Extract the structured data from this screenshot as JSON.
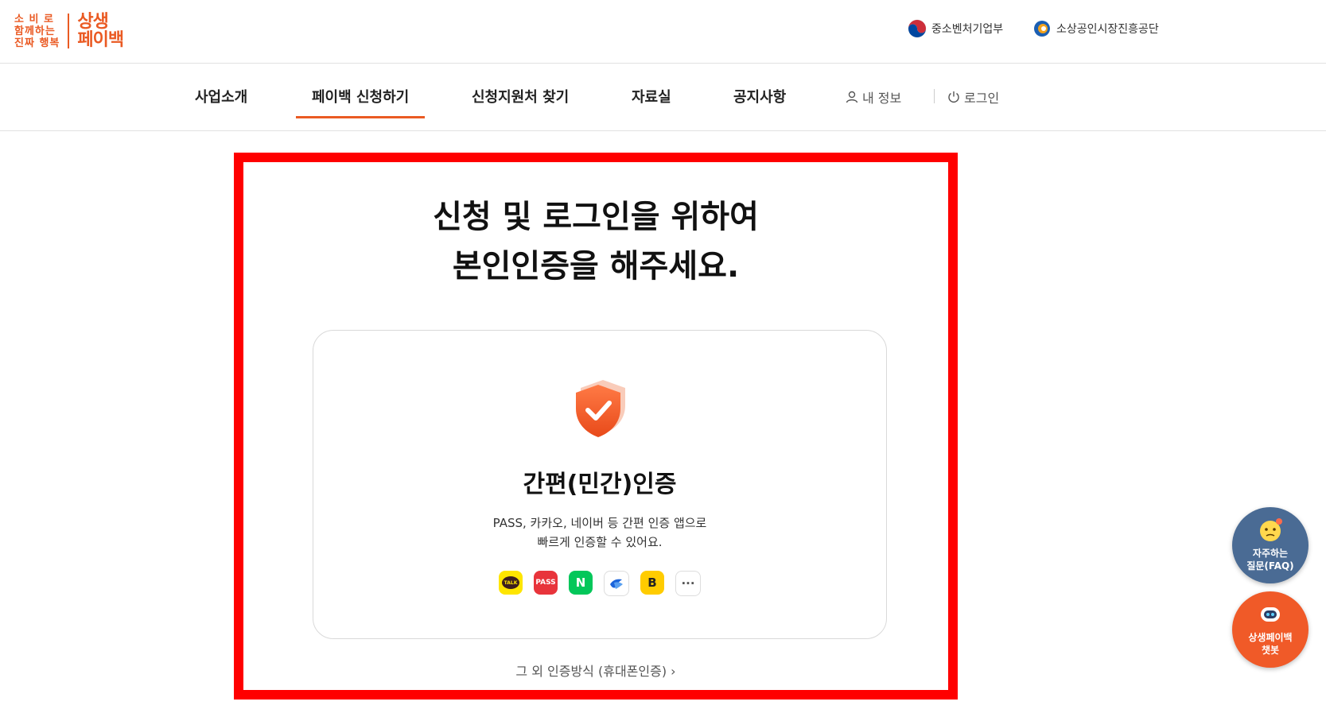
{
  "header": {
    "logo_small_lines": [
      "소 비 로",
      "함께하는",
      "진짜 행복"
    ],
    "logo_big_lines": [
      "상생",
      "페이백"
    ],
    "ministries": [
      {
        "label": "중소벤처기업부",
        "icon": "korea-emblem-icon"
      },
      {
        "label": "소상공인시장진흥공단",
        "icon": "semas-logo-icon"
      }
    ]
  },
  "nav": {
    "items": [
      {
        "label": "사업소개",
        "active": false
      },
      {
        "label": "페이백 신청하기",
        "active": true
      },
      {
        "label": "신청지원처 찾기",
        "active": false
      },
      {
        "label": "자료실",
        "active": false
      },
      {
        "label": "공지사항",
        "active": false
      }
    ],
    "my_info": "내 정보",
    "login": "로그인"
  },
  "main": {
    "headline_lines": [
      "신청 및 로그인을 위하여",
      "본인인증을 해주세요."
    ],
    "card": {
      "title": "간편(민간)인증",
      "desc_lines": [
        "PASS, 카카오, 네이버 등 간편 인증 앱으로",
        "빠르게 인증할 수 있어요."
      ],
      "providers": [
        {
          "name": "kakao-talk-icon",
          "text": "TALK",
          "bg": "#fee500",
          "fg": "#3c1e1e"
        },
        {
          "name": "pass-icon",
          "text": "PASS",
          "bg": "#e8343b",
          "fg": "#ffffff"
        },
        {
          "name": "naver-icon",
          "text": "N",
          "bg": "#03c75a",
          "fg": "#ffffff"
        },
        {
          "name": "toss-icon",
          "text": "",
          "bg": "#ffffff",
          "fg": "#1b64da"
        },
        {
          "name": "kb-icon",
          "text": "B",
          "bg": "#ffcc00",
          "fg": "#222222"
        },
        {
          "name": "more-icon",
          "text": "···",
          "bg": "#ffffff",
          "fg": "#555555"
        }
      ]
    },
    "other_methods": "그 외 인증방식 (휴대폰인증)"
  },
  "floating": {
    "faq_lines": [
      "자주하는",
      "질문(FAQ)"
    ],
    "chatbot_lines": [
      "상생페이백",
      "챗봇"
    ]
  },
  "colors": {
    "brand": "#ea5a23",
    "highlight_frame": "#ff0000",
    "faq_bg": "#4a6b94",
    "chatbot_bg": "#f05a28"
  }
}
